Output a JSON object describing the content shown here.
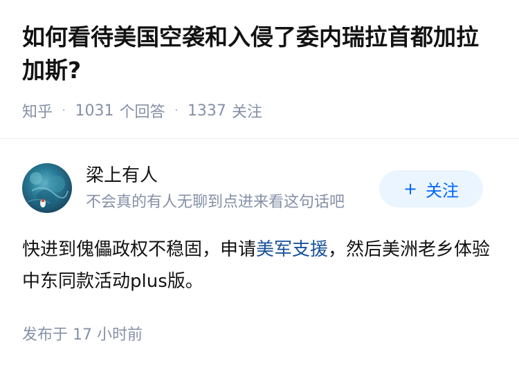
{
  "question": {
    "title": "如何看待美国空袭和入侵了委内瑞拉首都加拉加斯?",
    "source": "知乎",
    "answer_count": "1031",
    "answer_label": "个回答",
    "follow_count": "1337",
    "follow_label": "关注",
    "separator": "·"
  },
  "author": {
    "name": "梁上有人",
    "bio": "不会真的有人无聊到点进来看这句话吧",
    "follow_button": {
      "icon": "plus-icon",
      "label": "关注"
    }
  },
  "answer": {
    "text_before": "快进到傀儡政权不稳固，申请",
    "link_text": "美军支援",
    "text_after": "，然后美洲老乡体验中东同款活动plus版。",
    "published_prefix": "发布于",
    "published_time": "17 小时前"
  },
  "colors": {
    "accent": "#0066ff",
    "link": "#175199",
    "meta": "#8590a6",
    "follow_bg": "#ebf5ff"
  }
}
